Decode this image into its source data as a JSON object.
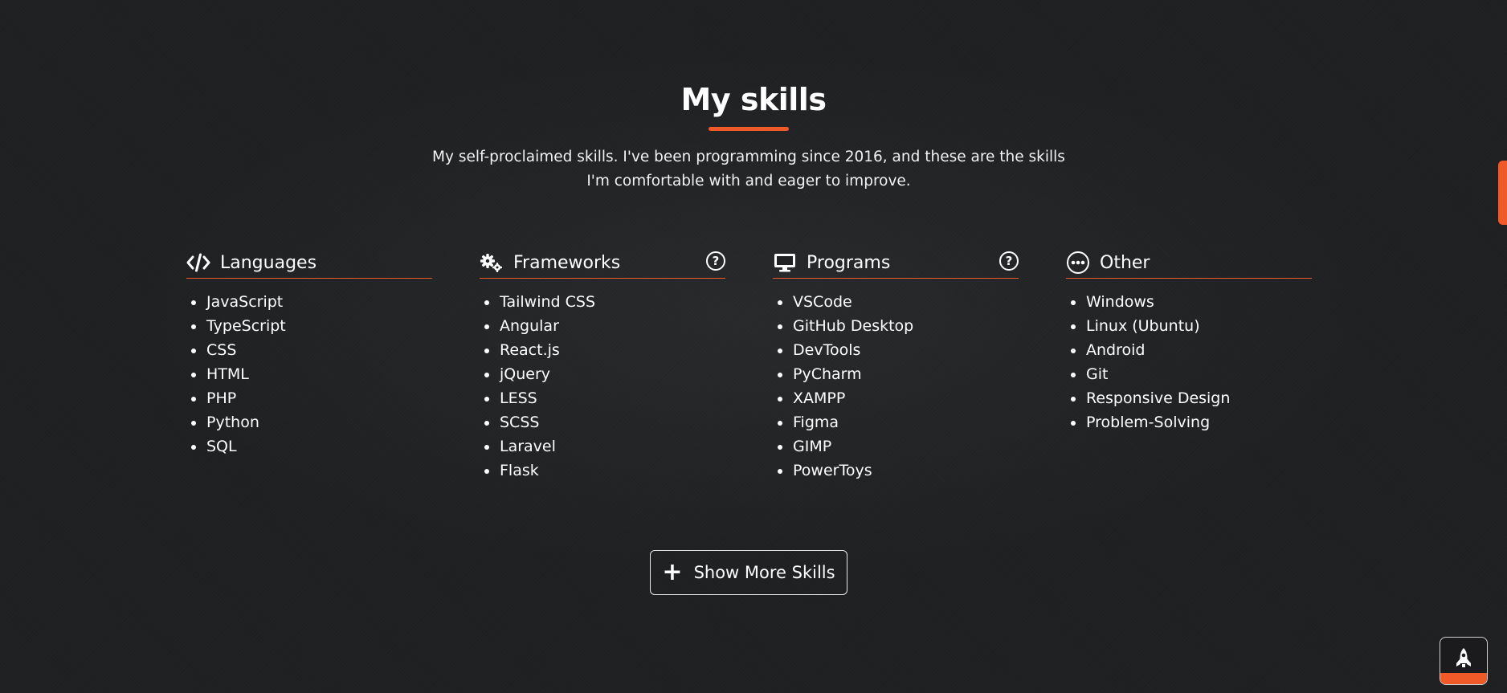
{
  "section": {
    "title": "My skills",
    "subtitle": "My self-proclaimed skills. I've been programming since 2016, and these are the skills I'm comfortable with and eager to improve."
  },
  "columns": [
    {
      "title": "Languages",
      "icon": "code-icon",
      "has_help": false,
      "items": [
        "JavaScript",
        "TypeScript",
        "CSS",
        "HTML",
        "PHP",
        "Python",
        "SQL"
      ]
    },
    {
      "title": "Frameworks",
      "icon": "gears-icon",
      "has_help": true,
      "items": [
        "Tailwind CSS",
        "Angular",
        "React.js",
        "jQuery",
        "LESS",
        "SCSS",
        "Laravel",
        "Flask"
      ]
    },
    {
      "title": "Programs",
      "icon": "desktop-icon",
      "has_help": true,
      "items": [
        "VSCode",
        "GitHub Desktop",
        "DevTools",
        "PyCharm",
        "XAMPP",
        "Figma",
        "GIMP",
        "PowerToys"
      ]
    },
    {
      "title": "Other",
      "icon": "ellipsis-circle-icon",
      "has_help": false,
      "items": [
        "Windows",
        "Linux (Ubuntu)",
        "Android",
        "Git",
        "Responsive Design",
        "Problem-Solving"
      ]
    }
  ],
  "help_glyph": "?",
  "show_more": {
    "icon": "plus-icon",
    "plus_glyph": "+",
    "label": "Show More Skills"
  },
  "scroll_to_top": {
    "icon": "rocket-icon",
    "progress_fraction": 0.25
  },
  "colors": {
    "accent": "#f05a28",
    "background": "#1f2022",
    "text": "#ffffff"
  }
}
